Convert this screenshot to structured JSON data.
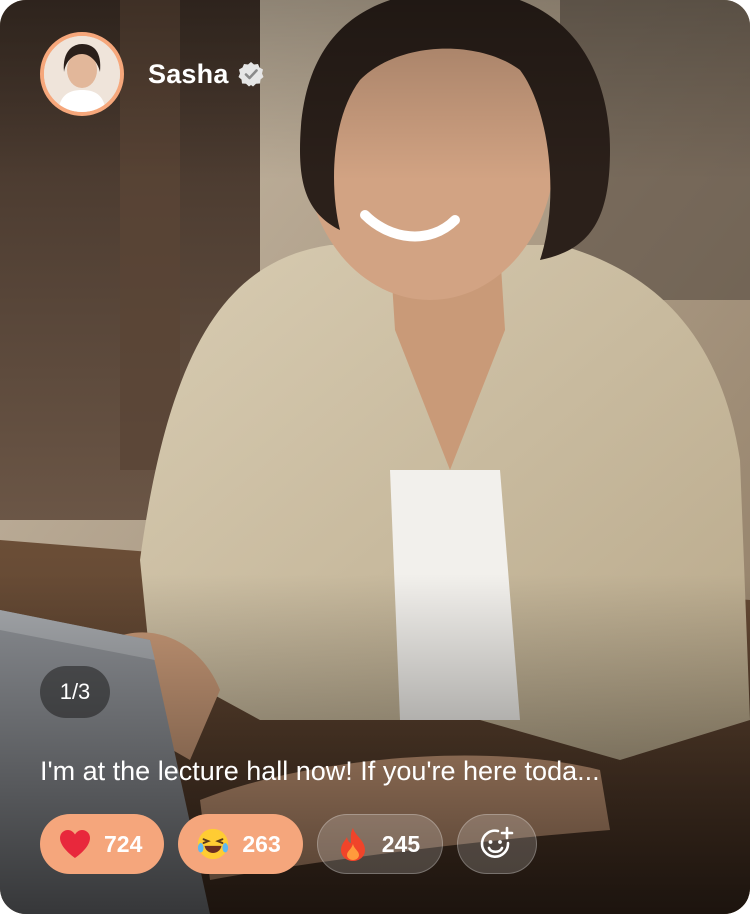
{
  "post": {
    "author_name": "Sasha",
    "verified": true,
    "pager": "1/3",
    "caption": "I'm at the lecture hall now! If you're here toda..."
  },
  "reactions": [
    {
      "icon": "heart-icon",
      "count": "724",
      "state": "active"
    },
    {
      "icon": "laughing-emoji-icon",
      "count": "263",
      "state": "active"
    },
    {
      "icon": "fire-icon",
      "count": "245",
      "state": "inactive"
    }
  ],
  "add_reaction": {
    "icon": "add-emoji-icon"
  },
  "colors": {
    "accent": "#f5a67c",
    "avatar_ring": "#f6a77b"
  }
}
